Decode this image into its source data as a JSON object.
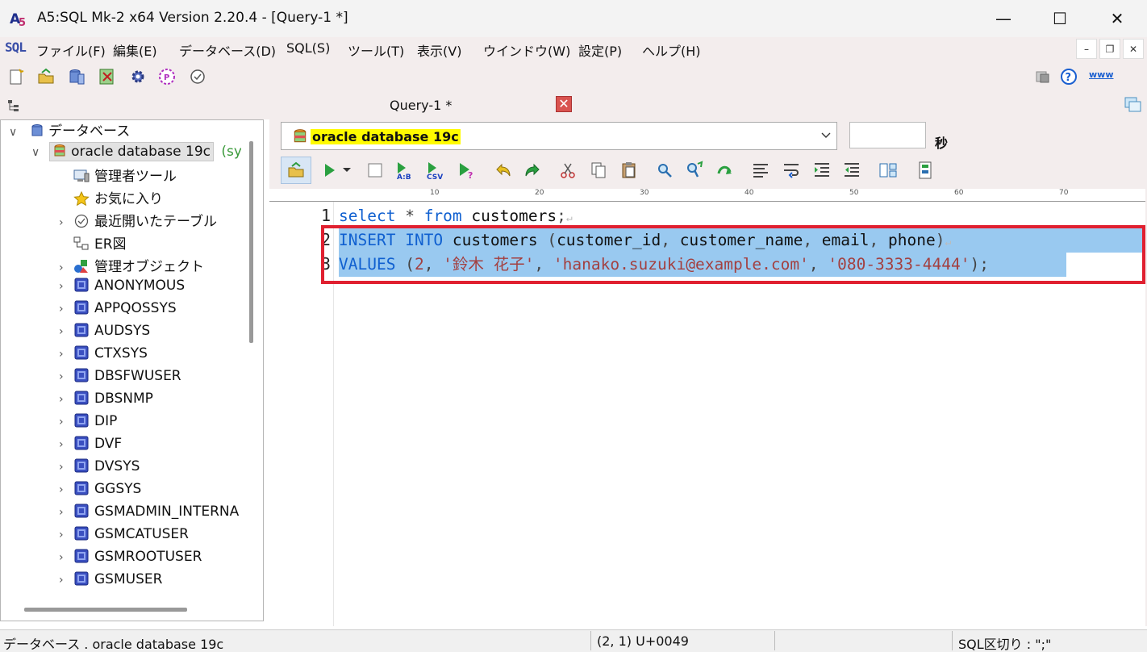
{
  "window": {
    "title": "A5:SQL Mk-2 x64 Version 2.20.4 - [Query-1 *]",
    "minimize": "—",
    "maximize": "☐",
    "close": "✕"
  },
  "menu": {
    "logo": "SQL",
    "items": [
      "ファイル(F)",
      "編集(E)",
      "データベース(D)",
      "SQL(S)",
      "ツール(T)",
      "表示(V)",
      "ウインドウ(W)",
      "設定(P)",
      "ヘルプ(H)"
    ],
    "mdi_min": "–",
    "mdi_restore": "❐",
    "mdi_close": "✕",
    "www": "www"
  },
  "tree": {
    "root": "データベース",
    "connection": "oracle database 19c",
    "connection_suffix": "(syst",
    "items": [
      {
        "label": "管理者ツール",
        "icon": "admin-tool-icon",
        "expander": ""
      },
      {
        "label": "お気に入り",
        "icon": "star-icon",
        "expander": ""
      },
      {
        "label": "最近開いたテーブル",
        "icon": "clock-icon",
        "expander": "›"
      },
      {
        "label": "ER図",
        "icon": "er-diagram-icon",
        "expander": ""
      },
      {
        "label": "管理オブジェクト",
        "icon": "objects-icon",
        "expander": "›"
      },
      {
        "label": "ANONYMOUS",
        "icon": "schema-icon",
        "expander": "›"
      },
      {
        "label": "APPQOSSYS",
        "icon": "schema-icon",
        "expander": "›"
      },
      {
        "label": "AUDSYS",
        "icon": "schema-icon",
        "expander": "›"
      },
      {
        "label": "CTXSYS",
        "icon": "schema-icon",
        "expander": "›"
      },
      {
        "label": "DBSFWUSER",
        "icon": "schema-icon",
        "expander": "›"
      },
      {
        "label": "DBSNMP",
        "icon": "schema-icon",
        "expander": "›"
      },
      {
        "label": "DIP",
        "icon": "schema-icon",
        "expander": "›"
      },
      {
        "label": "DVF",
        "icon": "schema-icon",
        "expander": "›"
      },
      {
        "label": "DVSYS",
        "icon": "schema-icon",
        "expander": "›"
      },
      {
        "label": "GGSYS",
        "icon": "schema-icon",
        "expander": "›"
      },
      {
        "label": "GSMADMIN_INTERNA",
        "icon": "schema-icon",
        "expander": "›"
      },
      {
        "label": "GSMCATUSER",
        "icon": "schema-icon",
        "expander": "›"
      },
      {
        "label": "GSMROOTUSER",
        "icon": "schema-icon",
        "expander": "›"
      },
      {
        "label": "GSMUSER",
        "icon": "schema-icon",
        "expander": "›"
      }
    ]
  },
  "query": {
    "tab_label": "Query-1 *",
    "tab_close": "✕",
    "connection_label": "oracle database 19c",
    "timeout_value": "",
    "seconds_label": "秒"
  },
  "ruler": [
    "10",
    "20",
    "30",
    "40",
    "50",
    "60",
    "70"
  ],
  "editor": {
    "line_numbers": [
      "1",
      "2",
      "3"
    ],
    "line1": {
      "kw1": "select",
      "p1": " * ",
      "kw2": "from",
      "t1": " customers",
      "p2": ";",
      "eol": "↵"
    },
    "line2": {
      "kw1": "INSERT",
      "s1": " ",
      "kw2": "INTO",
      "t1": " customers ",
      "p1": "(",
      "t2": "customer_id",
      "p2": ", ",
      "t3": "customer_name",
      "p3": ", ",
      "t4": "email",
      "p4": ", ",
      "t5": "phone",
      "p5": ")",
      "eol": "↵"
    },
    "line3": {
      "kw1": "VALUES",
      "p0": " (",
      "n1": "2",
      "p1": ", ",
      "s1": "'鈴木 花子'",
      "p2": ", ",
      "s2": "'hanako.suzuki@example.com'",
      "p3": ", ",
      "s3": "'080-3333-4444'",
      "p4": ");"
    }
  },
  "status": {
    "left": "データベース . oracle database 19c",
    "position": "(2, 1) U+0049",
    "delimiter": "SQL区切り : \";\""
  },
  "colors": {
    "keyword": "#1060d0",
    "string": "#a34040",
    "selection": "#99c9f0",
    "highlight_box": "#e02030",
    "connection_highlight": "#fffb00"
  }
}
